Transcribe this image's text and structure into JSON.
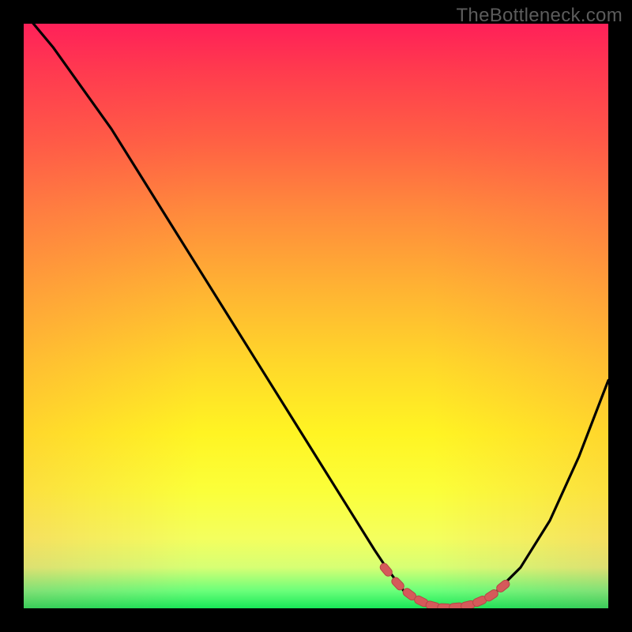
{
  "watermark": "TheBottleneck.com",
  "colors": {
    "background": "#000000",
    "watermark": "#5c5c5c",
    "curve": "#000000",
    "marker_fill": "#d55a5a",
    "marker_stroke": "#b74646",
    "gradient_top": "#ff1f58",
    "gradient_bottom": "#18e858"
  },
  "chart_data": {
    "type": "line",
    "title": "",
    "xlabel": "",
    "ylabel": "",
    "xlim": [
      0,
      100
    ],
    "ylim": [
      0,
      100
    ],
    "legend": false,
    "grid": false,
    "series": [
      {
        "name": "bottleneck-curve",
        "x": [
          0,
          5,
          10,
          15,
          20,
          25,
          30,
          35,
          40,
          45,
          50,
          55,
          60,
          62,
          65,
          68,
          70,
          73,
          76,
          80,
          85,
          90,
          95,
          100
        ],
        "values": [
          102,
          96,
          89,
          82,
          74,
          66,
          58,
          50,
          42,
          34,
          26,
          18,
          10,
          7,
          3,
          1,
          0.3,
          0.1,
          0.4,
          2,
          7,
          15,
          26,
          39
        ]
      }
    ],
    "markers": {
      "name": "optimal-range",
      "x": [
        62,
        64,
        66,
        68,
        70,
        72,
        74,
        76,
        78,
        80,
        82
      ],
      "values": [
        6.6,
        4.2,
        2.4,
        1.2,
        0.4,
        0.1,
        0.2,
        0.5,
        1.2,
        2.2,
        3.8
      ]
    },
    "annotations": []
  }
}
